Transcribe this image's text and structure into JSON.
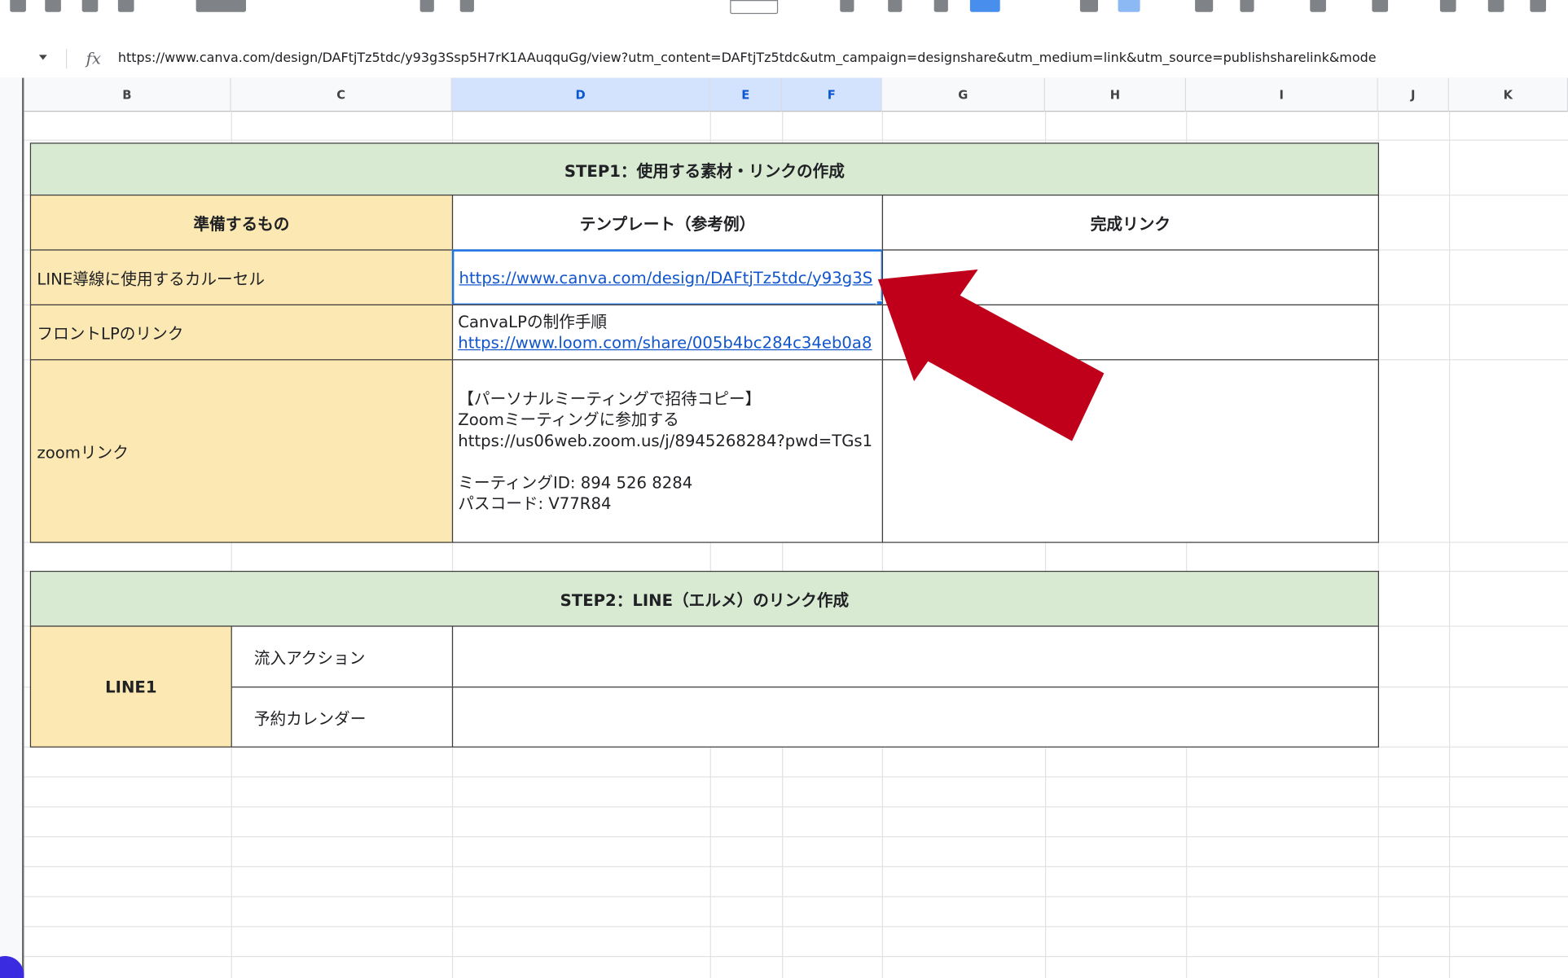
{
  "formula_bar": {
    "fx_label": "fx",
    "content": "https://www.canva.com/design/DAFtjTz5tdc/y93g3Ssp5H7rK1AAuqquGg/view?utm_content=DAFtjTz5tdc&utm_campaign=designshare&utm_medium=link&utm_source=publishsharelink&mode"
  },
  "columns": [
    "B",
    "C",
    "D",
    "E",
    "F",
    "G",
    "H",
    "I",
    "J",
    "K"
  ],
  "step1": {
    "title": "STEP1：使用する素材・リンクの作成",
    "headers": {
      "prep": "準備するもの",
      "template": "テンプレート（参考例）",
      "done": "完成リンク"
    },
    "rows": [
      {
        "label": "LINE導線に使用するカルーセル",
        "template_link": "https://www.canva.com/design/DAFtjTz5tdc/y93g3S"
      },
      {
        "label": "フロントLPのリンク",
        "template_text": "CanvaLPの制作手順",
        "template_link": "https://www.loom.com/share/005b4bc284c34eb0a8"
      },
      {
        "label": "zoomリンク",
        "lines": [
          "【パーソナルミーティングで招待コピー】",
          "Zoomミーティングに参加する",
          "https://us06web.zoom.us/j/8945268284?pwd=TGs1",
          "",
          "ミーティングID: 894 526 8284",
          "パスコード: V77R84"
        ]
      }
    ]
  },
  "step2": {
    "title": "STEP2：LINE（エルメ）のリンク作成",
    "group_label": "LINE1",
    "rows": [
      {
        "label": "流入アクション"
      },
      {
        "label": "予約カレンダー"
      }
    ]
  },
  "colors": {
    "header_green": "#d9ead3",
    "label_tan": "#fce8b2",
    "arrow_red": "#c0001a",
    "selection_blue": "#1a73e8"
  },
  "icons": [
    "dropdown-caret-icon",
    "fx-icon",
    "annotation-arrow-icon"
  ]
}
